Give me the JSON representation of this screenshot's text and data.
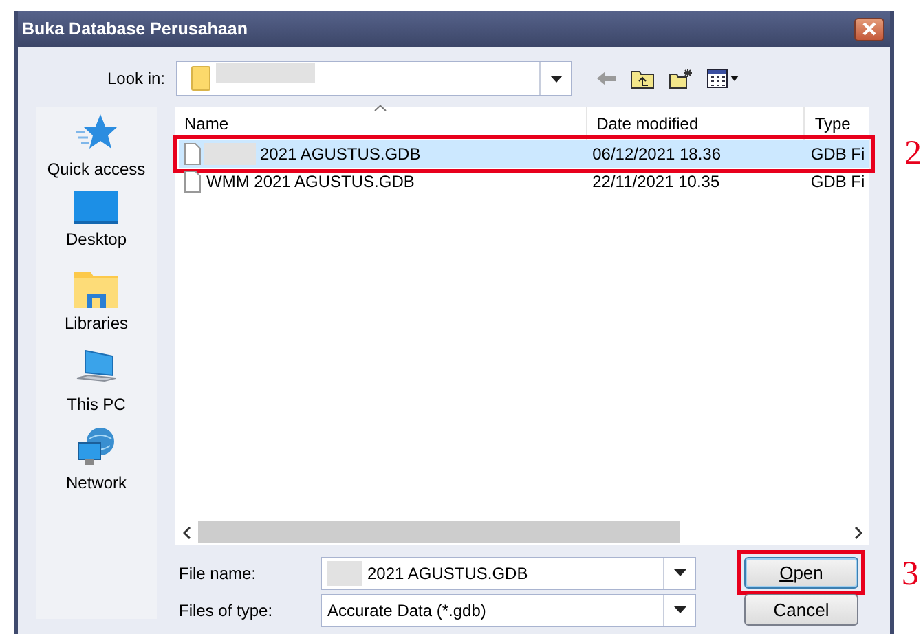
{
  "window": {
    "title": "Buka Database Perusahaan"
  },
  "look_in": {
    "label": "Look in:",
    "masked": true
  },
  "places": [
    {
      "label": "Quick access",
      "kind": "star"
    },
    {
      "label": "Desktop",
      "kind": "desktop"
    },
    {
      "label": "Libraries",
      "kind": "libraries"
    },
    {
      "label": "This PC",
      "kind": "pc"
    },
    {
      "label": "Network",
      "kind": "network"
    }
  ],
  "file_list": {
    "columns": [
      {
        "label": "Name",
        "sorted": true
      },
      {
        "label": "Date modified",
        "sorted": false
      },
      {
        "label": "Type",
        "sorted": false
      }
    ],
    "rows": [
      {
        "name": "2021 AGUSTUS.GDB",
        "masked": true,
        "date": "06/12/2021 18.36",
        "type": "GDB Fi",
        "selected": true,
        "annotation": "2"
      },
      {
        "name": "WMM 2021 AGUSTUS.GDB",
        "masked": false,
        "date": "22/11/2021 10.35",
        "type": "GDB Fi",
        "selected": false
      }
    ]
  },
  "file_name": {
    "label": "File name:",
    "value": "2021 AGUSTUS.GDB",
    "masked": true
  },
  "file_type": {
    "label": "Files of type:",
    "value": "Accurate Data (*.gdb)"
  },
  "buttons": [
    {
      "label": "Open",
      "first_letter_underlined": true,
      "default": true,
      "annotation": "3"
    },
    {
      "label": "Cancel",
      "default": false
    }
  ]
}
